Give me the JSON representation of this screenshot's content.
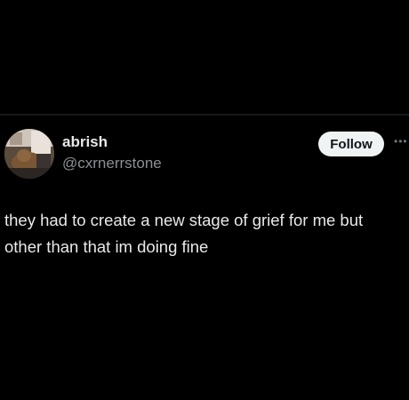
{
  "author": {
    "display_name": "abrish",
    "handle": "@cxrnerrstone",
    "avatar_icon": "profile-photo-avatar"
  },
  "actions": {
    "follow_label": "Follow",
    "more_icon": "more-options-icon"
  },
  "post": {
    "text": "they had to create a new stage of grief for me but\nother than that im doing fine"
  },
  "colors": {
    "background": "#000000",
    "primary_text": "#e7e9ea",
    "secondary_text": "#8b9095",
    "follow_button_bg": "#eff3f4",
    "follow_button_text": "#0f1419"
  }
}
